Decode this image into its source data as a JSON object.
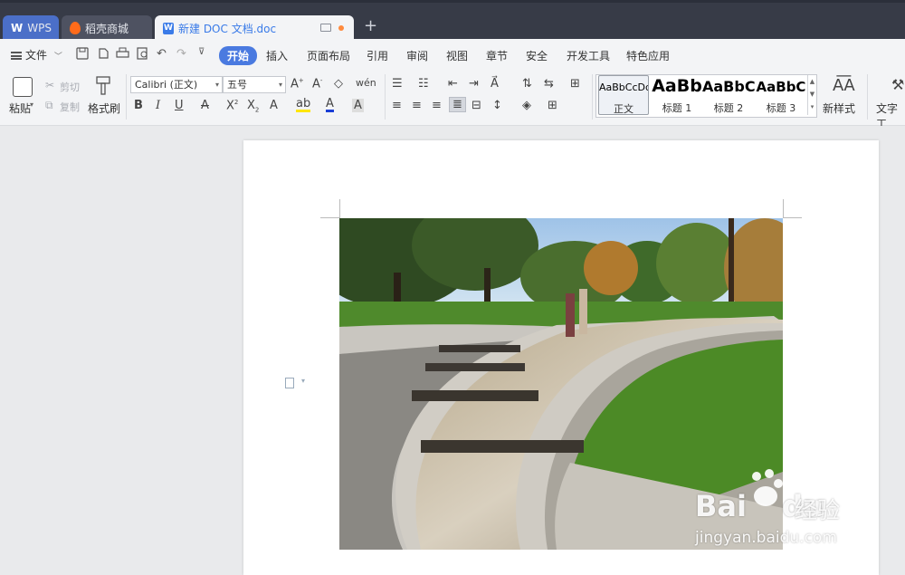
{
  "tabs": [
    {
      "label": "WPS",
      "icon": "wps-logo-icon"
    },
    {
      "label": "稻壳商城",
      "icon": "fire-icon"
    },
    {
      "label": "新建 DOC 文档.doc",
      "icon": "word-doc-icon"
    }
  ],
  "menu": {
    "file": "文件",
    "items": [
      "开始",
      "插入",
      "页面布局",
      "引用",
      "审阅",
      "视图",
      "章节",
      "安全",
      "开发工具",
      "特色应用"
    ],
    "active": "开始"
  },
  "ribbon": {
    "paste": "粘贴",
    "cut": "剪切",
    "copy": "复制",
    "format_painter": "格式刷",
    "font_name": "Calibri (正文)",
    "font_size": "五号",
    "new_style": "新样式",
    "text_tools": "文字工",
    "styles": [
      {
        "preview": "AaBbCcDd",
        "name": "正文"
      },
      {
        "preview": "AaBb",
        "name": "标题 1"
      },
      {
        "preview": "AaBbC",
        "name": "标题 2"
      },
      {
        "preview": "AaBbC",
        "name": "标题 3"
      }
    ]
  },
  "watermark": {
    "brand": "Bai",
    "brand2": "du",
    "cn": "经验",
    "url": "jingyan.baidu.com"
  },
  "colors": {
    "tabbar": "#373b47",
    "accent": "#4a7ae0",
    "active_tab_text": "#3a7be8"
  }
}
